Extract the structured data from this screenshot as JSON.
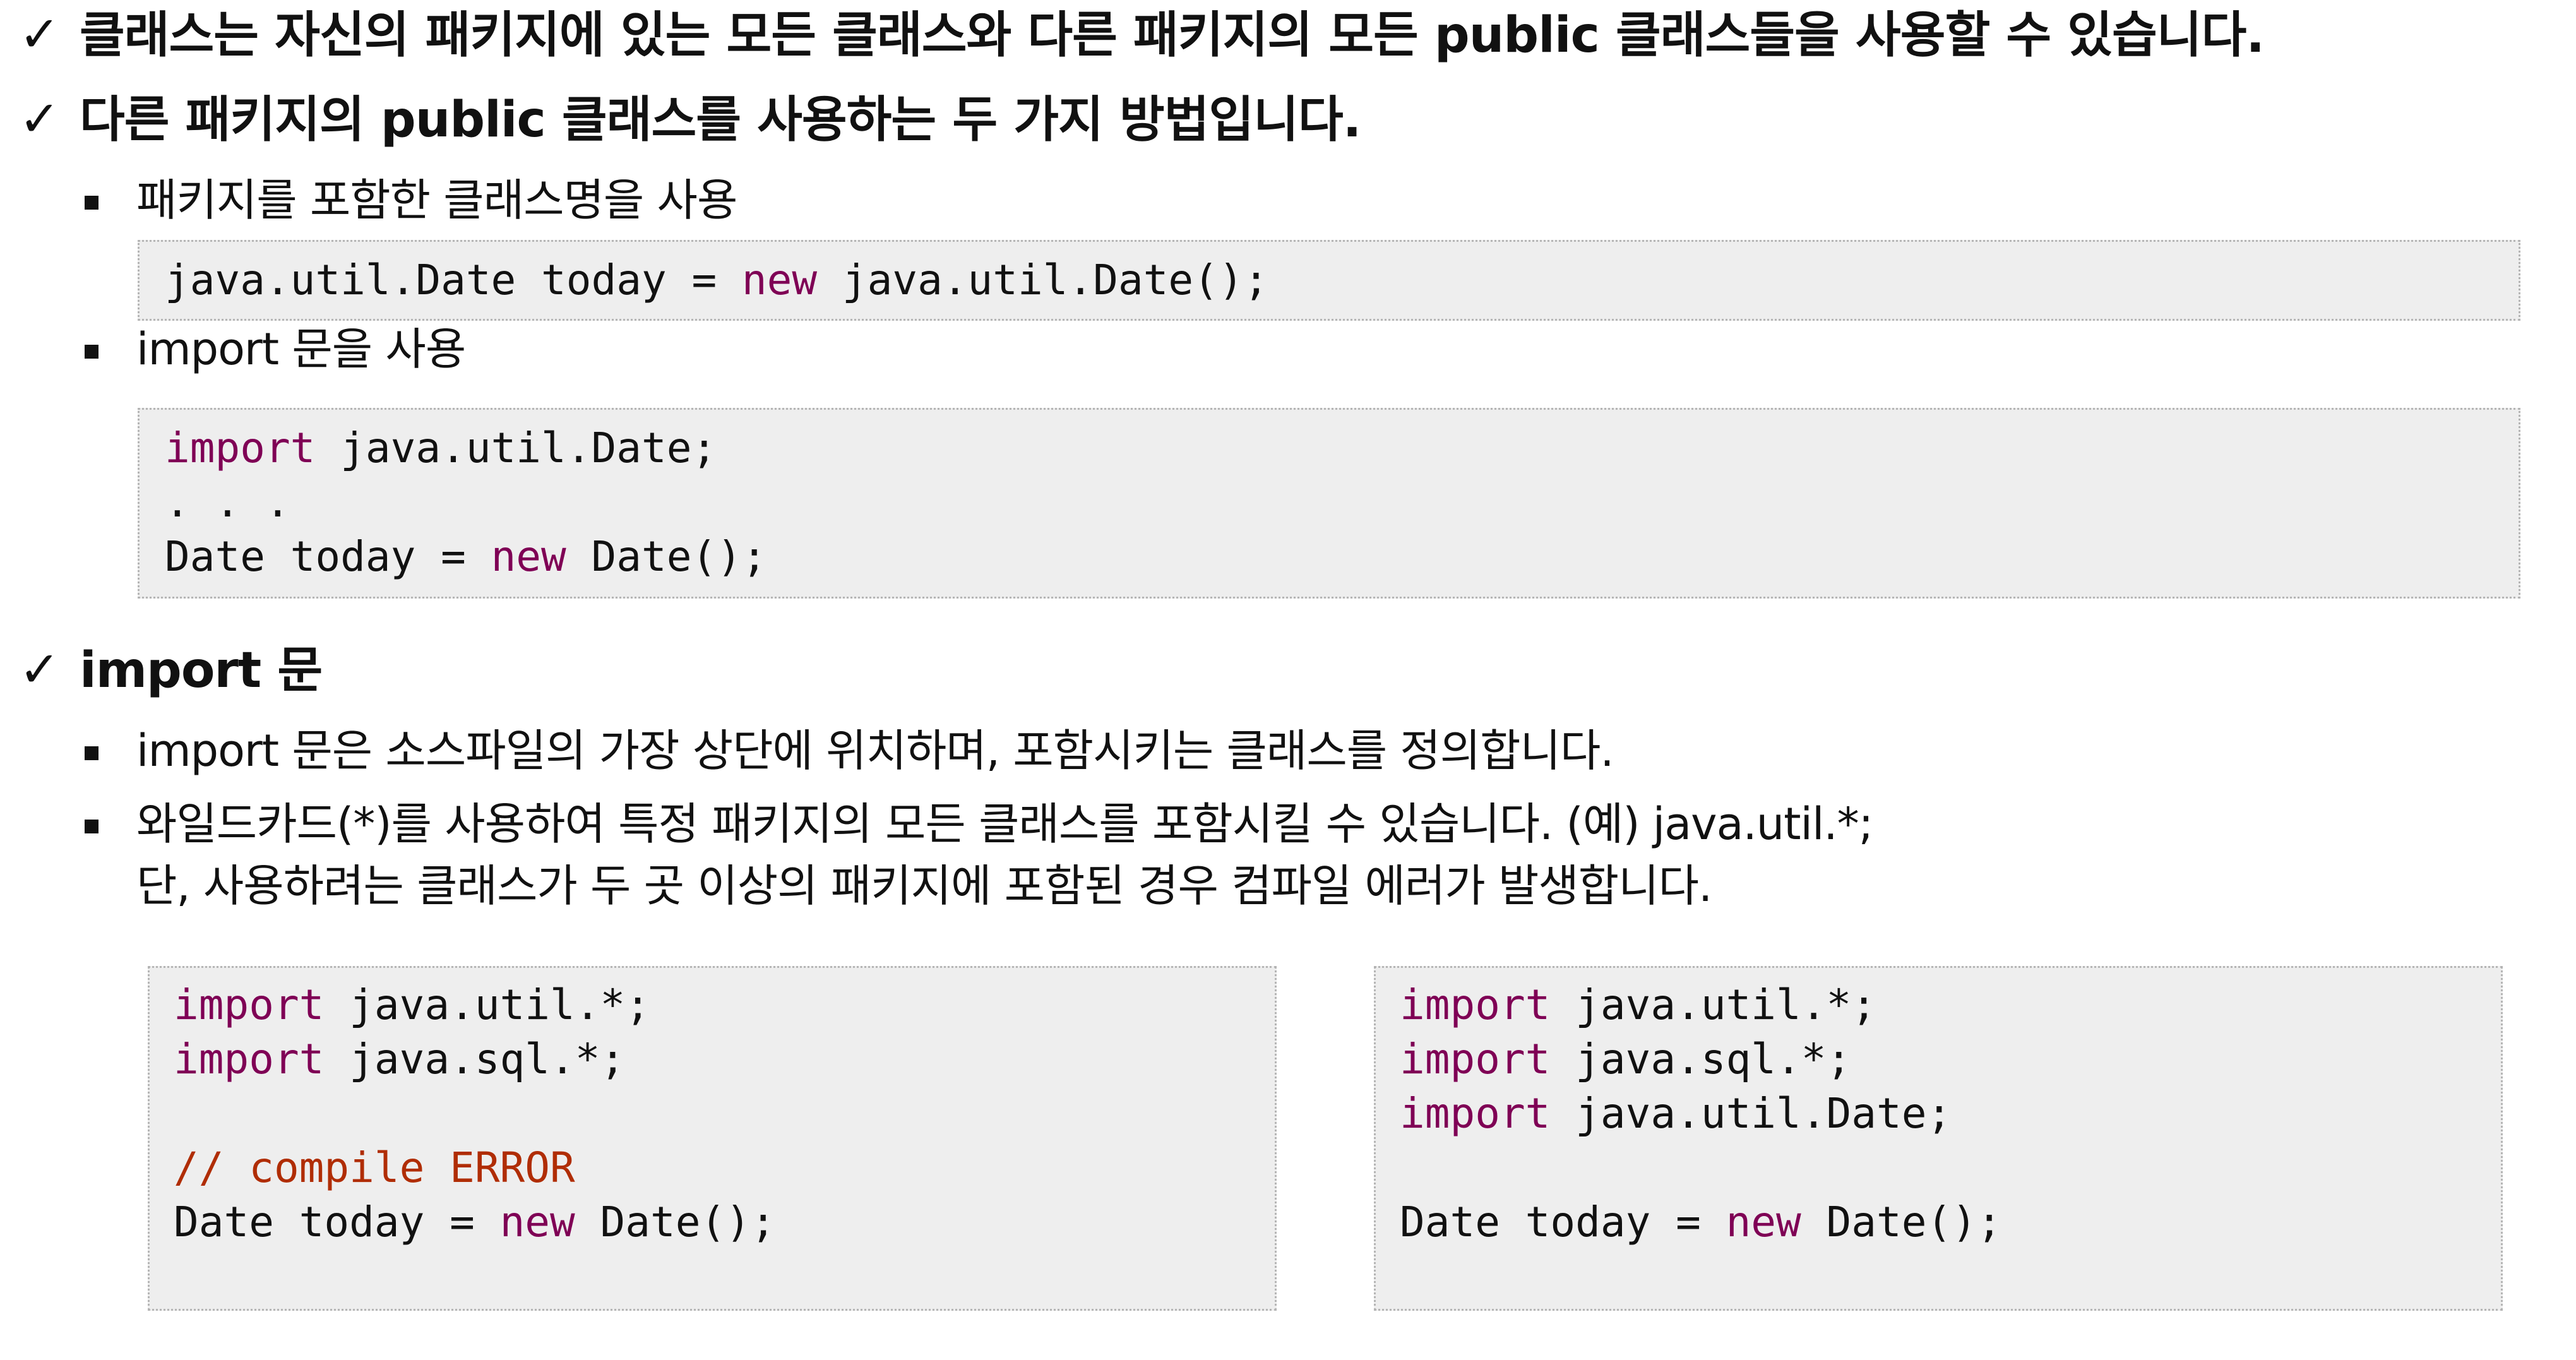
{
  "sections": [
    {
      "heading": "클래스는 자신의 패키지에 있는 모든 클래스와 다른 패키지의 모든 public 클래스들을 사용할 수 있습니다."
    },
    {
      "heading": "다른 패키지의 public 클래스를 사용하는 두 가지 방법입니다.",
      "bullets": [
        "패키지를 포함한 클래스명을 사용",
        "import 문을 사용"
      ],
      "code1": {
        "line1_prefix": "java.util.Date today = ",
        "line1_kw": "new",
        "line1_suffix": " java.util.Date();"
      },
      "code2": {
        "line1_kw": "import",
        "line1_rest": " java.util.Date;",
        "line2": ". . .",
        "line3_prefix": "Date today = ",
        "line3_kw": "new",
        "line3_suffix": " Date();"
      }
    },
    {
      "heading": "import 문",
      "bullets": [
        "import 문은 소스파일의 가장 상단에 위치하며, 포함시키는 클래스를 정의합니다.",
        "와일드카드(*)를 사용하여 특정 패키지의 모든 클래스를 포함시킬 수 있습니다. (예) java.util.*;",
        "단, 사용하려는 클래스가 두 곳 이상의 패키지에 포함된 경우 컴파일 에러가 발생합니다."
      ],
      "code_left": {
        "l1_kw": "import",
        "l1_rest": " java.util.*;",
        "l2_kw": "import",
        "l2_rest": " java.sql.*;",
        "comment": "// compile ERROR",
        "l4_prefix": "Date today = ",
        "l4_kw": "new",
        "l4_suffix": " Date();"
      },
      "code_right": {
        "l1_kw": "import",
        "l1_rest": " java.util.*;",
        "l2_kw": "import",
        "l2_rest": " java.sql.*;",
        "l3_kw": "import",
        "l3_rest": " java.util.Date;",
        "l4_prefix": "Date today = ",
        "l4_kw": "new",
        "l4_suffix": " Date();"
      }
    }
  ],
  "icons": {
    "check": "checkmark-icon",
    "bullet": "square-bullet-icon"
  }
}
